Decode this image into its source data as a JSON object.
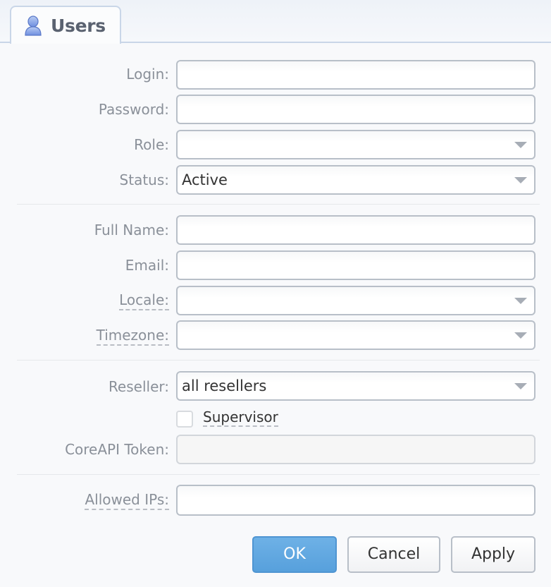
{
  "tab": {
    "title": "Users",
    "icon": "user-icon"
  },
  "form": {
    "login": {
      "label": "Login:",
      "value": ""
    },
    "password": {
      "label": "Password:",
      "value": ""
    },
    "role": {
      "label": "Role:",
      "value": ""
    },
    "status": {
      "label": "Status:",
      "value": "Active"
    },
    "full_name": {
      "label": "Full Name:",
      "value": ""
    },
    "email": {
      "label": "Email:",
      "value": ""
    },
    "locale": {
      "label": "Locale:",
      "value": ""
    },
    "timezone": {
      "label": "Timezone:",
      "value": ""
    },
    "reseller": {
      "label": "Reseller:",
      "value": "all resellers"
    },
    "supervisor": {
      "label": "Supervisor",
      "checked": false
    },
    "coreapi_token": {
      "label": "CoreAPI Token:",
      "value": ""
    },
    "allowed_ips": {
      "label": "Allowed IPs:",
      "value": ""
    }
  },
  "buttons": {
    "ok": "OK",
    "cancel": "Cancel",
    "apply": "Apply"
  },
  "colors": {
    "accent": "#5ea6e0",
    "label": "#8a9099",
    "tab_border": "#c9d6e8"
  }
}
